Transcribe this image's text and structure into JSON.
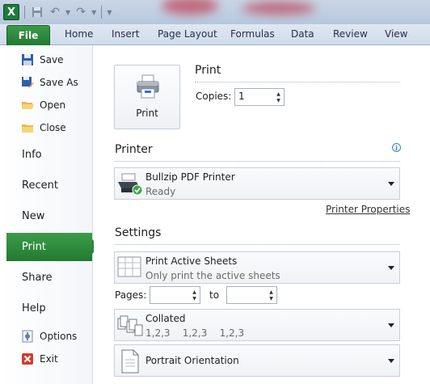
{
  "app": {
    "icon_letter": "X"
  },
  "ribbon": {
    "file_tab": "File",
    "tabs": [
      "Home",
      "Insert",
      "Page Layout",
      "Formulas",
      "Data",
      "Review",
      "View"
    ]
  },
  "nav": {
    "commands": [
      {
        "label": "Save",
        "icon": "save-icon"
      },
      {
        "label": "Save As",
        "icon": "save-as-icon"
      },
      {
        "label": "Open",
        "icon": "open-folder-icon"
      },
      {
        "label": "Close",
        "icon": "close-folder-icon"
      }
    ],
    "tabs": [
      "Info",
      "Recent",
      "New",
      "Print",
      "Share",
      "Help"
    ],
    "selected": "Print",
    "bottom": [
      {
        "label": "Options",
        "icon": "options-icon"
      },
      {
        "label": "Exit",
        "icon": "exit-icon"
      }
    ]
  },
  "print": {
    "heading": "Print",
    "button_label": "Print",
    "copies_label": "Copies:",
    "copies_value": "1"
  },
  "printer": {
    "heading": "Printer",
    "name": "Bullzip PDF Printer",
    "status": "Ready",
    "properties_link": "Printer Properties"
  },
  "settings": {
    "heading": "Settings",
    "scope_title": "Print Active Sheets",
    "scope_desc": "Only print the active sheets",
    "pages_label": "Pages:",
    "to_label": "to",
    "pages_from": "",
    "pages_to": "",
    "collate_title": "Collated",
    "collate_desc": "1,2,3    1,2,3    1,2,3",
    "orientation_title": "Portrait Orientation"
  },
  "colors": {
    "accent_green": "#227a31",
    "link": "#333333"
  }
}
